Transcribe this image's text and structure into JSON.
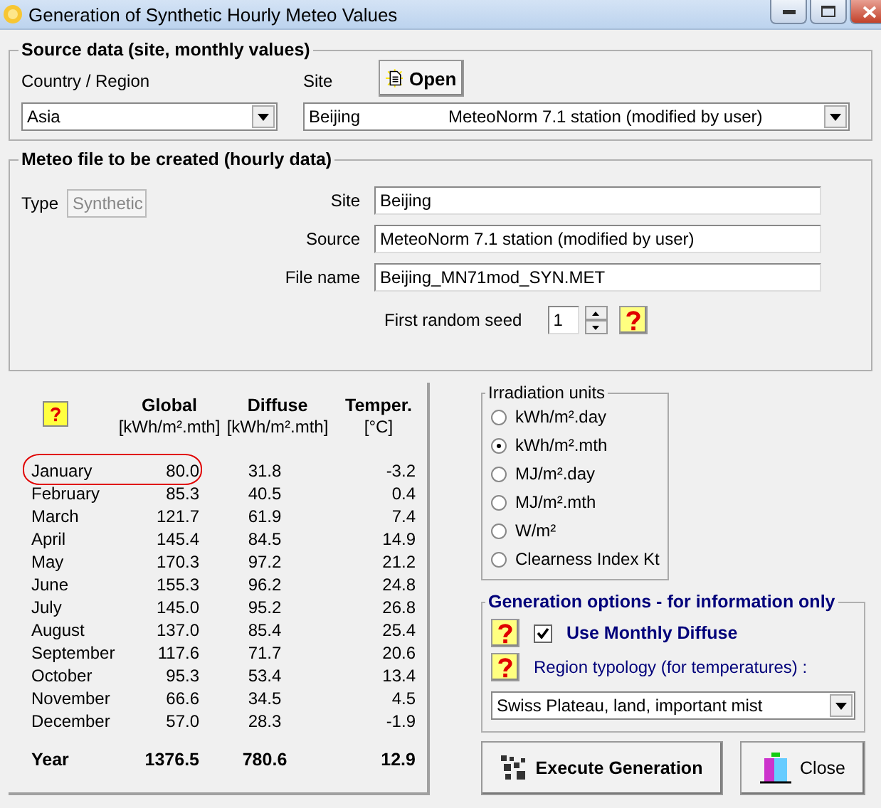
{
  "window": {
    "title": "Generation of Synthetic Hourly Meteo Values"
  },
  "source_data": {
    "title": "Source data  (site, monthly values)",
    "country_label": "Country / Region",
    "country_value": "Asia",
    "site_label": "Site",
    "open_button": "Open",
    "site_value": "Beijing",
    "site_source": "MeteoNorm 7.1 station (modified by user)"
  },
  "meteo_file": {
    "title": "Meteo file to be created (hourly data)",
    "type_label": "Type",
    "type_value": "Synthetic",
    "type_disabled": true,
    "fields": [
      {
        "label": "Site",
        "value": "Beijing"
      },
      {
        "label": "Source",
        "value": "MeteoNorm 7.1 station (modified by user)"
      },
      {
        "label": "File name",
        "value": "Beijing_MN71mod_SYN.MET"
      }
    ],
    "seed_label": "First random seed",
    "seed_value": "1"
  },
  "monthly_table": {
    "columns": [
      {
        "name": "Global",
        "unit": "[kWh/m².mth]"
      },
      {
        "name": "Diffuse",
        "unit": "[kWh/m².mth]"
      },
      {
        "name": "Temper.",
        "unit": "[°C]"
      }
    ],
    "rows": [
      {
        "month": "January",
        "global": "80.0",
        "diffuse": "31.8",
        "temper": "-3.2",
        "highlighted": true
      },
      {
        "month": "February",
        "global": "85.3",
        "diffuse": "40.5",
        "temper": "0.4",
        "highlighted": false
      },
      {
        "month": "March",
        "global": "121.7",
        "diffuse": "61.9",
        "temper": "7.4",
        "highlighted": false
      },
      {
        "month": "April",
        "global": "145.4",
        "diffuse": "84.5",
        "temper": "14.9",
        "highlighted": false
      },
      {
        "month": "May",
        "global": "170.3",
        "diffuse": "97.2",
        "temper": "21.2",
        "highlighted": false
      },
      {
        "month": "June",
        "global": "155.3",
        "diffuse": "96.2",
        "temper": "24.8",
        "highlighted": false
      },
      {
        "month": "July",
        "global": "145.0",
        "diffuse": "95.2",
        "temper": "26.8",
        "highlighted": false
      },
      {
        "month": "August",
        "global": "137.0",
        "diffuse": "85.4",
        "temper": "25.4",
        "highlighted": false
      },
      {
        "month": "September",
        "global": "117.6",
        "diffuse": "71.7",
        "temper": "20.6",
        "highlighted": false
      },
      {
        "month": "October",
        "global": "95.3",
        "diffuse": "53.4",
        "temper": "13.4",
        "highlighted": false
      },
      {
        "month": "November",
        "global": "66.6",
        "diffuse": "34.5",
        "temper": "4.5",
        "highlighted": false
      },
      {
        "month": "December",
        "global": "57.0",
        "diffuse": "28.3",
        "temper": "-1.9",
        "highlighted": false
      }
    ],
    "total": {
      "month": "Year",
      "global": "1376.5",
      "diffuse": "780.6",
      "temper": "12.9"
    }
  },
  "irradiation_units": {
    "title": "Irradiation units",
    "options": [
      {
        "label": "kWh/m².day",
        "selected": false
      },
      {
        "label": "kWh/m².mth",
        "selected": true
      },
      {
        "label": "MJ/m².day",
        "selected": false
      },
      {
        "label": "MJ/m².mth",
        "selected": false
      },
      {
        "label": "W/m²",
        "selected": false
      },
      {
        "label": "Clearness Index Kt",
        "selected": false
      }
    ]
  },
  "generation_options": {
    "title": "Generation options - for information only",
    "use_monthly_diffuse": {
      "label": "Use Monthly Diffuse",
      "checked": true
    },
    "region_label": "Region typology  (for temperatures) :",
    "region_value": "Swiss Plateau, land, important mist"
  },
  "buttons": [
    {
      "label": "Execute Generation",
      "kind": "execute"
    },
    {
      "label": "Close",
      "kind": "close"
    }
  ]
}
